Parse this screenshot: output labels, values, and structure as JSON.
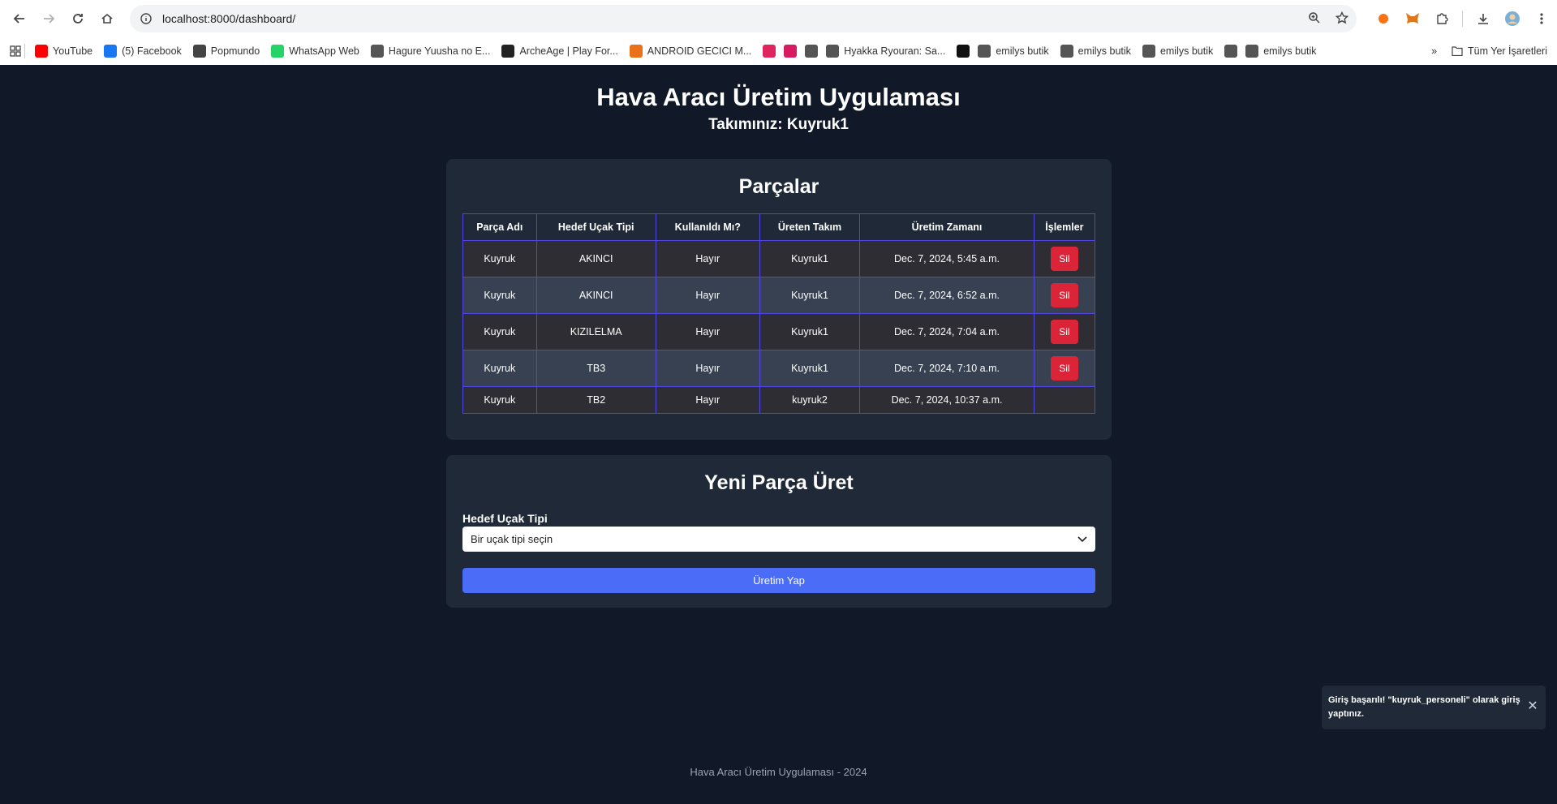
{
  "browser": {
    "url": "localhost:8000/dashboard/",
    "bookmarks": [
      {
        "label": "YouTube",
        "icon": "youtube-icon",
        "color": "#ff0000"
      },
      {
        "label": "(5) Facebook",
        "icon": "facebook-icon",
        "color": "#1877f2"
      },
      {
        "label": "Popmundo",
        "icon": "popmundo-icon",
        "color": "#444444"
      },
      {
        "label": "WhatsApp Web",
        "icon": "whatsapp-icon",
        "color": "#25d366"
      },
      {
        "label": "Hagure Yuusha no E...",
        "icon": "site-icon",
        "color": "#555555"
      },
      {
        "label": "ArcheAge | Play For...",
        "icon": "archeage-icon",
        "color": "#222222"
      },
      {
        "label": "ANDROID GECICI M...",
        "icon": "dh-icon",
        "color": "#e8711a"
      },
      {
        "label": "",
        "icon": "heart-icon",
        "color": "#e0245e"
      },
      {
        "label": "",
        "icon": "figure-icon",
        "color": "#d81b60"
      },
      {
        "label": "",
        "icon": "globe-icon",
        "color": "#555555"
      },
      {
        "label": "Hyakka Ryouran: Sa...",
        "icon": "site-icon",
        "color": "#555555"
      },
      {
        "label": "",
        "icon": "qr-icon",
        "color": "#111111"
      },
      {
        "label": "emilys butik",
        "icon": "globe-icon",
        "color": "#555555"
      },
      {
        "label": "emilys butik",
        "icon": "globe-icon",
        "color": "#555555"
      },
      {
        "label": "emilys butik",
        "icon": "globe-icon",
        "color": "#555555"
      },
      {
        "label": "",
        "icon": "globe-icon",
        "color": "#555555"
      },
      {
        "label": "emilys butik",
        "icon": "globe-icon",
        "color": "#555555"
      }
    ],
    "all_bookmarks": "Tüm Yer İşaretleri"
  },
  "header": {
    "title": "Hava Aracı Üretim Uygulaması",
    "team": "Takımınız: Kuyruk1"
  },
  "parts": {
    "heading": "Parçalar",
    "columns": [
      "Parça Adı",
      "Hedef Uçak Tipi",
      "Kullanıldı Mı?",
      "Üreten Takım",
      "Üretim Zamanı",
      "İşlemler"
    ],
    "rows": [
      {
        "name": "Kuyruk",
        "target": "AKINCI",
        "used": "Hayır",
        "team": "Kuyruk1",
        "time": "Dec. 7, 2024, 5:45 a.m.",
        "action": "Sil"
      },
      {
        "name": "Kuyruk",
        "target": "AKINCI",
        "used": "Hayır",
        "team": "Kuyruk1",
        "time": "Dec. 7, 2024, 6:52 a.m.",
        "action": "Sil"
      },
      {
        "name": "Kuyruk",
        "target": "KIZILELMA",
        "used": "Hayır",
        "team": "Kuyruk1",
        "time": "Dec. 7, 2024, 7:04 a.m.",
        "action": "Sil"
      },
      {
        "name": "Kuyruk",
        "target": "TB3",
        "used": "Hayır",
        "team": "Kuyruk1",
        "time": "Dec. 7, 2024, 7:10 a.m.",
        "action": "Sil"
      },
      {
        "name": "Kuyruk",
        "target": "TB2",
        "used": "Hayır",
        "team": "kuyruk2",
        "time": "Dec. 7, 2024, 10:37 a.m.",
        "action": ""
      }
    ]
  },
  "new_part": {
    "heading": "Yeni Parça Üret",
    "label": "Hedef Uçak Tipi",
    "select_value": "Bir uçak tipi seçin",
    "button": "Üretim Yap"
  },
  "footer": "Hava Aracı Üretim Uygulaması - 2024",
  "toast": "Giriş başarılı! \"kuyruk_personeli\" olarak giriş yaptınız.",
  "colors": {
    "background": "#111827",
    "card": "#1f2937",
    "border": "#4f46e5",
    "danger": "#dc2438",
    "primary": "#4a6cf7"
  }
}
